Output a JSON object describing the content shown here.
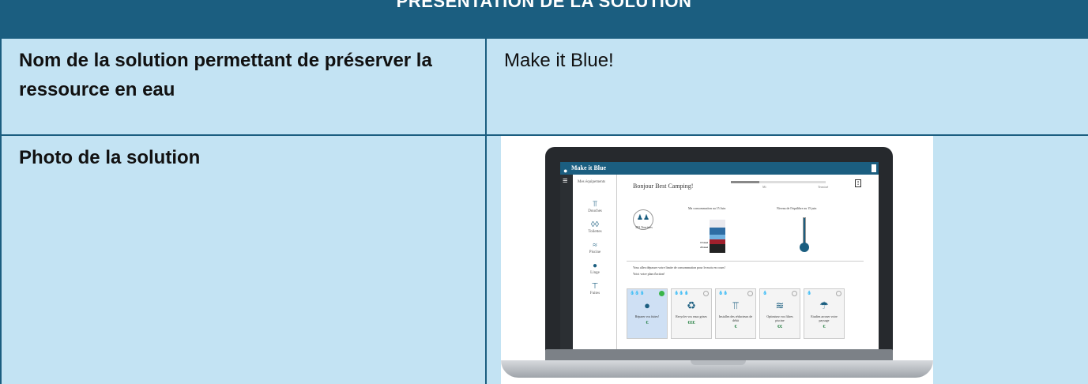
{
  "header": {
    "title": "PRÉSENTATION DE LA SOLUTION"
  },
  "rows": [
    {
      "label": "Nom de la solution permettant de préserver la ressource en eau",
      "value": "Make it Blue!"
    },
    {
      "label": "Photo de la solution",
      "value": ""
    }
  ],
  "colors": {
    "banner": "#1b5e80",
    "cell": "#c3e3f3",
    "border": "#1b5e80"
  },
  "photo": {
    "app_name": "Make it Blue",
    "nav_heading": "Mes équipements",
    "nav_items": [
      {
        "label": "Douches",
        "icon": "shower-icon"
      },
      {
        "label": "Toilettes",
        "icon": "toilet-icon"
      },
      {
        "label": "Piscine",
        "icon": "swimmer-icon"
      },
      {
        "label": "Linge",
        "icon": "water-drop-icon"
      },
      {
        "label": "Fuites",
        "icon": "faucet-icon"
      }
    ],
    "greeting": "Bonjour Best Camping!",
    "progress_fraction": 0.3,
    "progress_labels": [
      "Mi",
      "Terminé"
    ],
    "occupancy": "582 Touristes",
    "consumption_title": "Ma consommation au 15 Juin",
    "equilibrium_title": "Niveau de l'équilibre au 15 juin",
    "stack_labels": [
      "15 mai",
      "20 mai"
    ],
    "message_1": "Vous allez dépasser votre limite de consommation pour le mois en cours!",
    "message_2": "Voici votre plan d'action!",
    "cards": [
      {
        "drops": "💧💧💧",
        "icon": "water-drop-icon",
        "text": "Réparer vos fuites!",
        "price": "€",
        "selected": true
      },
      {
        "drops": "💧💧💧",
        "icon": "recycle-icon",
        "text": "Recycler vos eaux grises",
        "price": "€€€",
        "selected": false
      },
      {
        "drops": "💧💧",
        "icon": "shower-icon",
        "text": "Installez des réducteurs de débit",
        "price": "€",
        "selected": false
      },
      {
        "drops": "💧",
        "icon": "pool-icon",
        "text": "Optimisez vos filtres piscine",
        "price": "€€",
        "selected": false
      },
      {
        "drops": "💧",
        "icon": "sprinkler-icon",
        "text": "Etudiez arroser votre paysage",
        "price": "€",
        "selected": false
      }
    ]
  }
}
